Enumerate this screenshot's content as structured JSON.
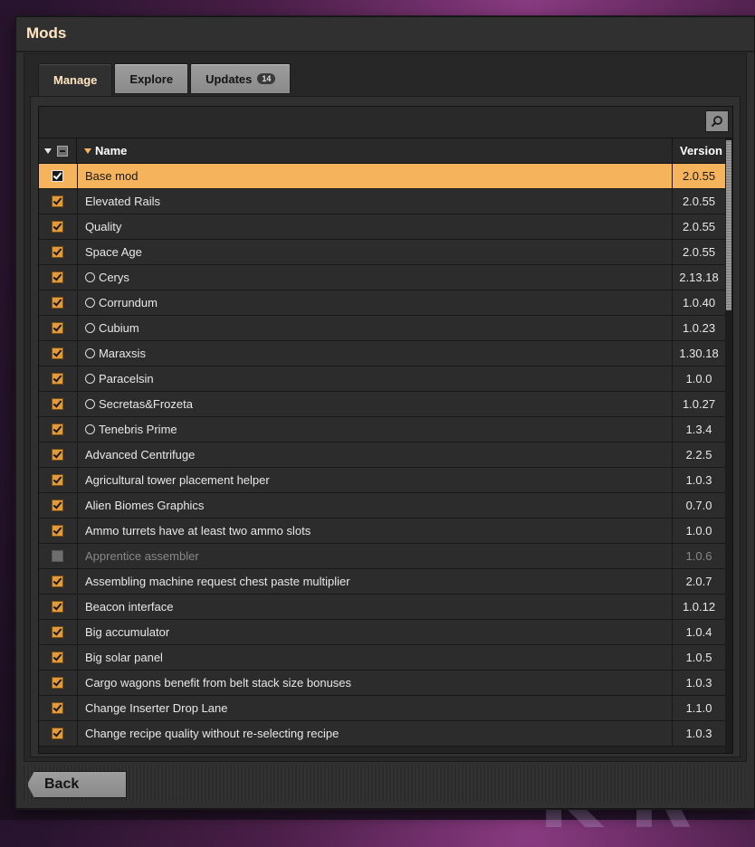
{
  "window": {
    "title": "Mods"
  },
  "tabs": [
    {
      "label": "Manage"
    },
    {
      "label": "Explore"
    },
    {
      "label": "Updates",
      "badge": "14"
    }
  ],
  "table": {
    "header": {
      "name": "Name",
      "version": "Version"
    },
    "rows": [
      {
        "name": "Base mod",
        "version": "2.0.55",
        "enabled": true,
        "selected": true,
        "circle": false
      },
      {
        "name": "Elevated Rails",
        "version": "2.0.55",
        "enabled": true,
        "circle": false
      },
      {
        "name": "Quality",
        "version": "2.0.55",
        "enabled": true,
        "circle": false
      },
      {
        "name": "Space Age",
        "version": "2.0.55",
        "enabled": true,
        "circle": false
      },
      {
        "name": "Cerys",
        "version": "2.13.18",
        "enabled": true,
        "circle": true
      },
      {
        "name": "Corrundum",
        "version": "1.0.40",
        "enabled": true,
        "circle": true
      },
      {
        "name": "Cubium",
        "version": "1.0.23",
        "enabled": true,
        "circle": true
      },
      {
        "name": "Maraxsis",
        "version": "1.30.18",
        "enabled": true,
        "circle": true
      },
      {
        "name": "Paracelsin",
        "version": "1.0.0",
        "enabled": true,
        "circle": true
      },
      {
        "name": "Secretas&Frozeta",
        "version": "1.0.27",
        "enabled": true,
        "circle": true
      },
      {
        "name": "Tenebris Prime",
        "version": "1.3.4",
        "enabled": true,
        "circle": true
      },
      {
        "name": "Advanced Centrifuge",
        "version": "2.2.5",
        "enabled": true,
        "circle": false
      },
      {
        "name": "Agricultural tower placement helper",
        "version": "1.0.3",
        "enabled": true,
        "circle": false
      },
      {
        "name": "Alien Biomes Graphics",
        "version": "0.7.0",
        "enabled": true,
        "circle": false
      },
      {
        "name": "Ammo turrets have at least two ammo slots",
        "version": "1.0.0",
        "enabled": true,
        "circle": false
      },
      {
        "name": "Apprentice assembler",
        "version": "1.0.6",
        "enabled": false,
        "circle": false
      },
      {
        "name": "Assembling machine request chest paste multiplier",
        "version": "2.0.7",
        "enabled": true,
        "circle": false
      },
      {
        "name": "Beacon interface",
        "version": "1.0.12",
        "enabled": true,
        "circle": false
      },
      {
        "name": "Big accumulator",
        "version": "1.0.4",
        "enabled": true,
        "circle": false
      },
      {
        "name": "Big solar panel",
        "version": "1.0.5",
        "enabled": true,
        "circle": false
      },
      {
        "name": "Cargo wagons benefit from belt stack size bonuses",
        "version": "1.0.3",
        "enabled": true,
        "circle": false
      },
      {
        "name": "Change Inserter Drop Lane",
        "version": "1.1.0",
        "enabled": true,
        "circle": false
      },
      {
        "name": "Change recipe quality without re-selecting recipe",
        "version": "1.0.3",
        "enabled": true,
        "circle": false
      }
    ]
  },
  "footer": {
    "back_label": "Back"
  },
  "icons": {
    "search": "magnifier-icon",
    "sort": "sort-desc-icon",
    "select_all": "select-all-checkbox-icon",
    "row_check": "checkbox-icon",
    "row_status": "circle-icon"
  },
  "colors": {
    "accent": "#f5b35c",
    "checkbox": "#e39a3a",
    "title": "#ffe6c0"
  }
}
